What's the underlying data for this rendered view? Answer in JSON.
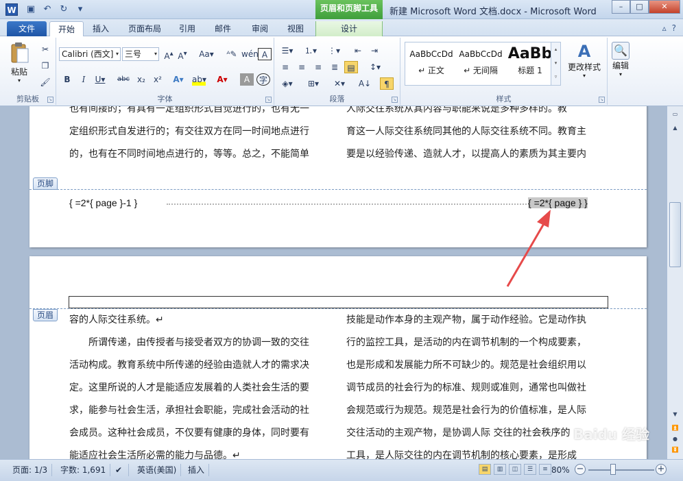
{
  "titlebar": {
    "app_icon": "W",
    "contextual_tab_title": "页眉和页脚工具",
    "window_title": "新建 Microsoft Word 文档.docx - Microsoft Word"
  },
  "tabs": {
    "file": "文件",
    "items": [
      "开始",
      "插入",
      "页面布局",
      "引用",
      "邮件",
      "审阅",
      "视图",
      "设计"
    ],
    "active": "开始"
  },
  "ribbon": {
    "clipboard": {
      "paste": "粘贴",
      "label": "剪贴板"
    },
    "font": {
      "name": "Calibri (西文]",
      "size": "三号",
      "label": "字体"
    },
    "paragraph": {
      "label": "段落"
    },
    "styles": {
      "label": "样式",
      "items": [
        {
          "sample": "AaBbCcDd",
          "name": "↵ 正文"
        },
        {
          "sample": "AaBbCcDd",
          "name": "↵ 无间隔"
        },
        {
          "sample": "AaBb",
          "name": "标题 1"
        }
      ],
      "change_styles": "更改样式"
    },
    "editing": {
      "label": "编辑"
    }
  },
  "document": {
    "page1_left_lines": [
      "也有间接的；有具有一定组织形式自觉进行的，也有无一",
      "定组织形式自发进行的；有交往双方在同一时间地点进行",
      "的，也有在不同时间地点进行的，等等。总之，不能简单"
    ],
    "page1_right_lines": [
      "人际交往系统从其内容与职能来说是多种多样的。教",
      "育这一人际交往系统同其他的人际交往系统不同。教育主",
      "要是以经验传递、造就人才，以提高人的素质为其主要内"
    ],
    "footer_tag": "页脚",
    "footer_left_field": "{ =2*{ page }-1 }",
    "footer_right_field": "{ =2*{ page } }",
    "header_tag": "页眉",
    "page2_left_lines": [
      "容的人际交往系统。↵",
      "　　所谓传递，由传授者与接受者双方的协调一致的交往",
      "活动构成。教育系统中所传递的经验由造就人才的需求决",
      "定。这里所说的人才是能适应发展着的人类社会生活的要",
      "求，能参与社会生活，承担社会职能，完成社会活动的社",
      "会成员。这种社会成员，不仅要有健康的身体，同时要有",
      "能适应社会生活所必需的能力与品德。↵"
    ],
    "page2_right_lines": [
      "技能是动作本身的主观产物，属于动作经验。它是动作执",
      "行的监控工具，是活动的内在调节机制的一个构成要素，",
      "也是形成和发展能力所不可缺少的。规范是社会组织用以",
      "调节成员的社会行为的标准、规则或准则，通常也叫做社",
      "会规范或行为规范。规范是社会行为的价值标准，是人际",
      "交往活动的主观产物，是协调人际 交往的社会秩序的",
      "工具，是人际交往的内在调节机制的核心要素，是形成"
    ]
  },
  "statusbar": {
    "page": "页面: 1/3",
    "words": "字数: 1,691",
    "language": "英语(美国)",
    "mode": "插入",
    "zoom": "80%"
  },
  "watermark": "Baidu 经验"
}
